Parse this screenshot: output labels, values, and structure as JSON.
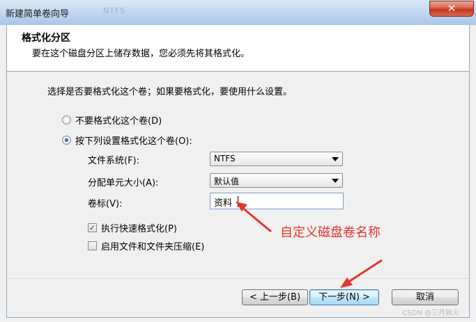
{
  "window": {
    "title": "新建简单卷向导",
    "background_text": "NTFS",
    "close_glyph": "✕"
  },
  "header": {
    "title": "格式化分区",
    "subtitle": "要在这个磁盘分区上储存数据，您必须先将其格式化。"
  },
  "prompt": "选择是否要格式化这个卷；如果要格式化，要使用什么设置。",
  "options": {
    "no_format": {
      "label": "不要格式化这个卷(D)",
      "selected": false
    },
    "format": {
      "label": "按下列设置格式化这个卷(O):",
      "selected": true
    }
  },
  "fields": {
    "file_system": {
      "label": "文件系统(F):",
      "value": "NTFS"
    },
    "allocation": {
      "label": "分配单元大小(A):",
      "value": "默认值"
    },
    "volume_label": {
      "label": "卷标(V):",
      "value": "资料"
    }
  },
  "checks": {
    "quick_format": {
      "label": "执行快速格式化(P)",
      "checked": true,
      "glyph": "✓"
    },
    "compression": {
      "label": "启用文件和文件夹压缩(E)",
      "checked": false
    }
  },
  "annotation": {
    "text": "自定义磁盘卷名称",
    "color": "#e5332f"
  },
  "buttons": {
    "back": "< 上一步(B)",
    "next": "下一步(N) >",
    "cancel": "取消"
  },
  "watermark": "CSDN @三月枫火"
}
